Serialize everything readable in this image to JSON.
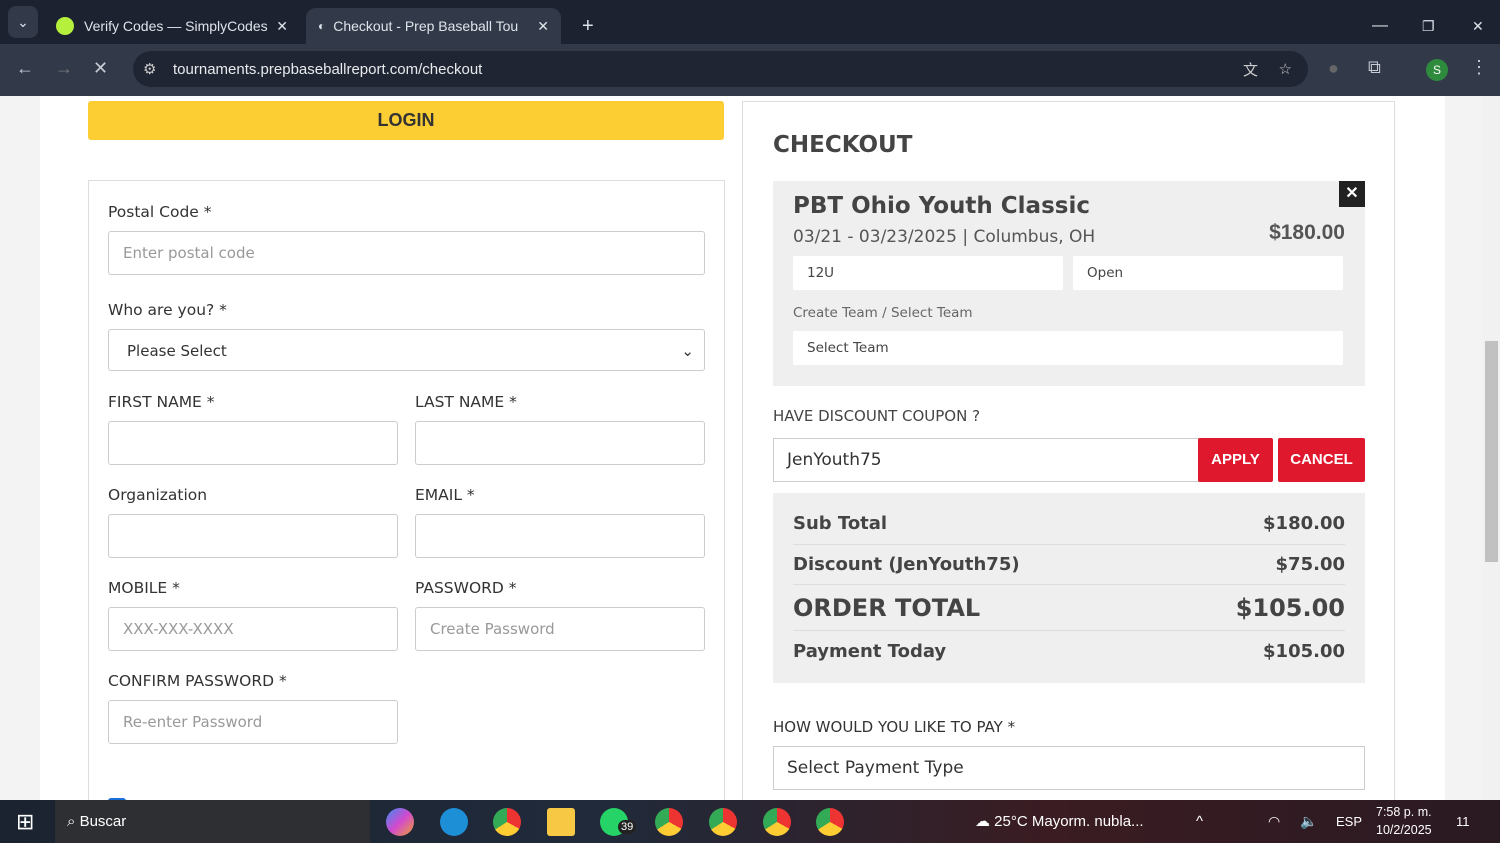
{
  "browser": {
    "tabs": [
      {
        "title": "Verify Codes — SimplyCodes"
      },
      {
        "title": "Checkout - Prep Baseball Tourn"
      }
    ],
    "url": "tournaments.prepbaseballreport.com/checkout",
    "profile": "S"
  },
  "form": {
    "login": "LOGIN",
    "postal_label": "Postal Code *",
    "postal_ph": "Enter postal code",
    "who_label": "Who are you? *",
    "who_value": "Please Select",
    "first": "FIRST NAME *",
    "last": "LAST NAME *",
    "org": "Organization",
    "email": "EMAIL *",
    "mobile": "MOBILE *",
    "mobile_ph": "XXX-XXX-XXXX",
    "password": "PASSWORD *",
    "password_ph": "Create Password",
    "confirm": "CONFIRM PASSWORD *",
    "confirm_ph": "Re-enter Password"
  },
  "checkout": {
    "title": "CHECKOUT",
    "event": "PBT Ohio Youth Classic",
    "dates": "03/21 - 03/23/2025 | Columbus, OH",
    "price": "$180.00",
    "age": "12U",
    "division": "Open",
    "team_label": "Create Team / Select Team",
    "team_value": "Select Team",
    "coupon_label": "HAVE DISCOUNT COUPON ?",
    "coupon_value": "JenYouth75",
    "apply": "APPLY",
    "cancel": "CANCEL",
    "summary": [
      {
        "label": "Sub Total",
        "value": "$180.00"
      },
      {
        "label": "Discount (JenYouth75)",
        "value": "$75.00"
      },
      {
        "label": "ORDER TOTAL",
        "value": "$105.00"
      },
      {
        "label": "Payment Today",
        "value": "$105.00"
      }
    ],
    "pay_label": "HOW WOULD YOU LIKE TO PAY *",
    "pay_value": "Select Payment Type"
  },
  "taskbar": {
    "search": "Buscar",
    "whatsapp_badge": "39",
    "weather": "25°C  Mayorm. nubla...",
    "lang": "ESP",
    "time": "7:58 p. m.",
    "date": "10/2/2025",
    "notif": "11"
  }
}
